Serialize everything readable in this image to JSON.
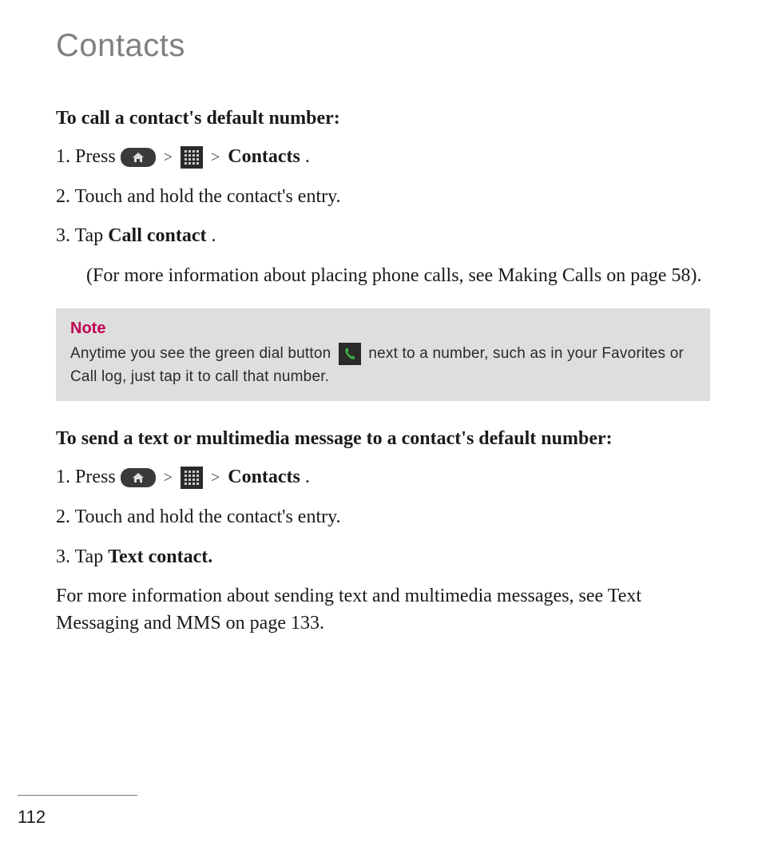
{
  "title": "Contacts",
  "section1": {
    "heading": "To call a contact's default number:",
    "step1_prefix": "1. Press",
    "step1_contacts": "Contacts",
    "step1_period": ".",
    "step2": "2. Touch and hold the contact's entry.",
    "step3_prefix": "3. Tap ",
    "step3_bold": "Call contact",
    "step3_period": ".",
    "step3_indent": "(For more information about placing phone calls, see Making Calls on page 58)."
  },
  "note": {
    "label": "Note",
    "text_before": "Anytime you see the green dial button ",
    "text_after": " next to a number, such as in your Favorites or Call log, just tap it to call that number."
  },
  "section2": {
    "heading": "To send a text or multimedia message to a contact's default number:",
    "step1_prefix": "1. Press",
    "step1_contacts": "Contacts",
    "step1_period": ".",
    "step2": "2. Touch and hold the contact's entry.",
    "step3_prefix": "3. Tap ",
    "step3_bold": "Text contact.",
    "para": "For more information about sending text and multimedia messages, see Text Messaging and MMS on page 133."
  },
  "chevron": ">",
  "page_number": "112"
}
